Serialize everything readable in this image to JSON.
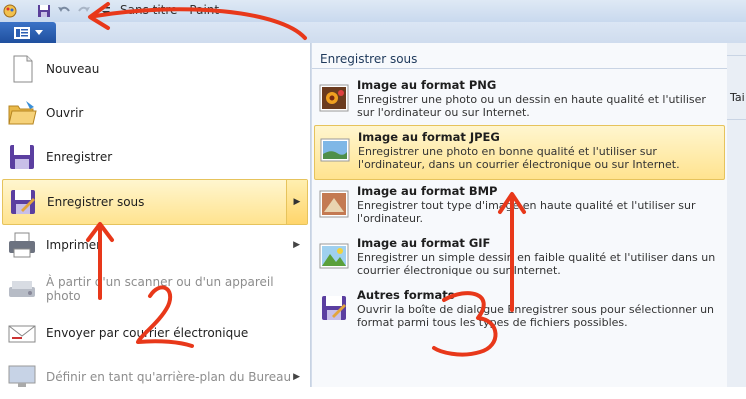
{
  "titlebar": {
    "title": "Sans titre - Paint"
  },
  "left_menu": {
    "items": [
      {
        "label": "Nouveau",
        "icon": "new-document-icon"
      },
      {
        "label": "Ouvrir",
        "icon": "open-folder-icon"
      },
      {
        "label": "Enregistrer",
        "icon": "save-floppy-icon"
      },
      {
        "label": "Enregistrer sous",
        "icon": "save-as-icon",
        "selected": true
      },
      {
        "label": "Imprimer",
        "icon": "printer-icon"
      },
      {
        "label": "À partir d'un scanner ou d'un appareil photo",
        "icon": "scanner-icon",
        "disabled": true
      },
      {
        "label": "Envoyer par courrier électronique",
        "icon": "email-icon"
      },
      {
        "label": "Définir en tant qu'arrière-plan du Bureau",
        "icon": "desktop-background-icon",
        "disabled": true
      }
    ]
  },
  "save_as_panel": {
    "header": "Enregistrer sous",
    "options": [
      {
        "title": "Image au format PNG",
        "desc": "Enregistrer une photo ou un dessin en haute qualité et l'utiliser sur l'ordinateur ou sur Internet.",
        "icon": "png-image-icon"
      },
      {
        "title": "Image au format JPEG",
        "desc": "Enregistrer une photo en bonne qualité et l'utiliser sur l'ordinateur, dans un courrier électronique ou sur Internet.",
        "icon": "jpeg-image-icon",
        "selected": true
      },
      {
        "title": "Image au format BMP",
        "desc": "Enregistrer tout type d'image en haute qualité et l'utiliser sur l'ordinateur.",
        "icon": "bmp-image-icon"
      },
      {
        "title": "Image au format GIF",
        "desc": "Enregistrer un simple dessin en faible qualité et l'utiliser dans un courrier électronique ou sur Internet.",
        "icon": "gif-image-icon"
      },
      {
        "title": "Autres formats",
        "desc": "Ouvrir la boîte de dialogue Enregistrer sous pour sélectionner un format parmi tous les types de fichiers possibles.",
        "icon": "other-formats-icon"
      }
    ]
  },
  "background_app": {
    "partial_label": "Tai"
  },
  "annotations": {
    "step_2": "2",
    "step_3": "3",
    "color": "#e8381a"
  },
  "colors": {
    "highlight": "#ffe38f",
    "app_button": "#2c5fb3"
  }
}
